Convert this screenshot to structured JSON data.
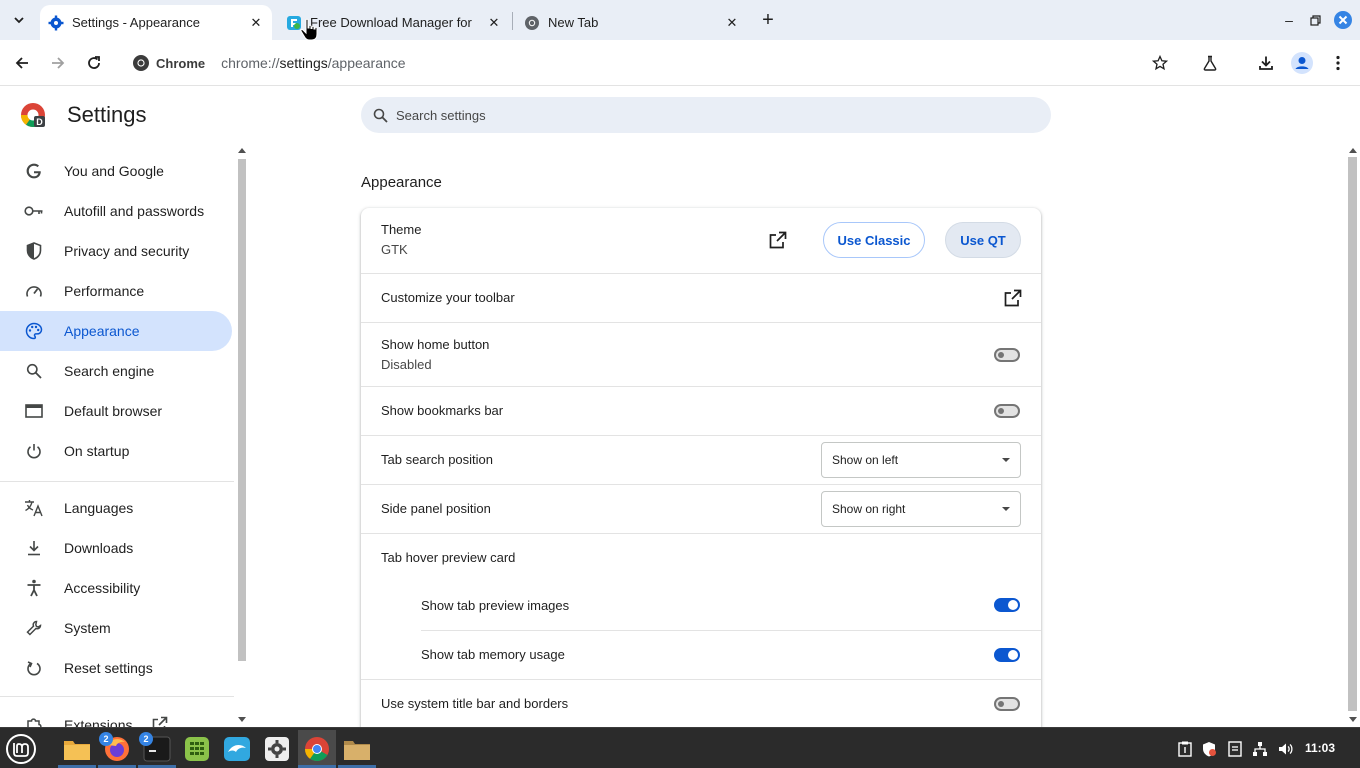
{
  "browser": {
    "tabs": [
      {
        "title": "Settings - Appearance",
        "active": true,
        "favicon": "gear-icon"
      },
      {
        "title": "Free Download Manager for",
        "active": false,
        "favicon": "fdm-icon"
      },
      {
        "title": "New Tab",
        "active": false,
        "favicon": "chrome-icon"
      }
    ],
    "omnibox": {
      "chip_label": "Chrome",
      "url_scheme": "chrome://",
      "url_host": "settings",
      "url_path": "/appearance"
    }
  },
  "settings": {
    "title": "Settings",
    "search_placeholder": "Search settings",
    "nav": [
      {
        "label": "You and Google",
        "icon": "google-g-icon"
      },
      {
        "label": "Autofill and passwords",
        "icon": "key-icon"
      },
      {
        "label": "Privacy and security",
        "icon": "shield-icon"
      },
      {
        "label": "Performance",
        "icon": "speedometer-icon"
      },
      {
        "label": "Appearance",
        "icon": "palette-icon",
        "active": true
      },
      {
        "label": "Search engine",
        "icon": "search-icon"
      },
      {
        "label": "Default browser",
        "icon": "browser-window-icon"
      },
      {
        "label": "On startup",
        "icon": "power-icon"
      },
      {
        "label": "Languages",
        "icon": "translate-icon"
      },
      {
        "label": "Downloads",
        "icon": "download-icon"
      },
      {
        "label": "Accessibility",
        "icon": "accessibility-icon"
      },
      {
        "label": "System",
        "icon": "wrench-icon"
      },
      {
        "label": "Reset settings",
        "icon": "reset-icon"
      },
      {
        "label": "Extensions",
        "icon": "puzzle-icon"
      }
    ],
    "section_title": "Appearance",
    "rows": {
      "theme": {
        "label": "Theme",
        "value": "GTK",
        "use_classic": "Use Classic",
        "use_qt": "Use QT"
      },
      "toolbar": {
        "label": "Customize your toolbar"
      },
      "home_button": {
        "label": "Show home button",
        "value": "Disabled",
        "on": false
      },
      "bookmarks_bar": {
        "label": "Show bookmarks bar",
        "on": false
      },
      "tab_search": {
        "label": "Tab search position",
        "selected": "Show on left"
      },
      "side_panel": {
        "label": "Side panel position",
        "selected": "Show on right"
      },
      "hover_card": {
        "label": "Tab hover preview card"
      },
      "preview_images": {
        "label": "Show tab preview images",
        "on": true
      },
      "memory_usage": {
        "label": "Show tab memory usage",
        "on": true
      },
      "system_title_bar": {
        "label": "Use system title bar and borders",
        "on": false
      }
    }
  },
  "taskbar": {
    "badges": {
      "firefox": "2",
      "terminal": "2"
    },
    "clock": "11:03"
  },
  "colors": {
    "accent": "#0b57d0",
    "active_nav_bg": "#d3e3fd",
    "tabstrip_bg": "#e9eef6",
    "taskbar_bg": "#2b2b2b"
  }
}
